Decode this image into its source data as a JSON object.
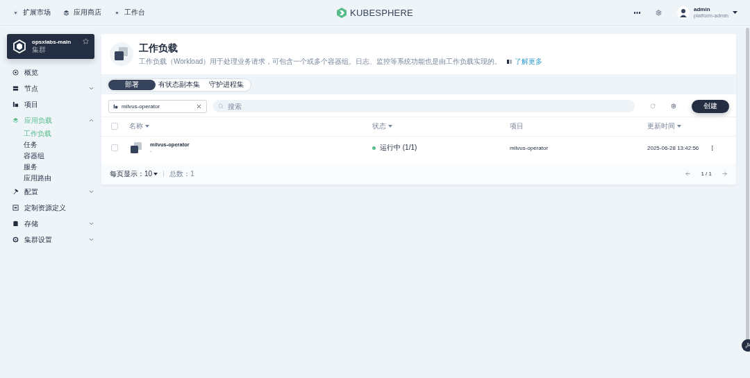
{
  "top_nav": {
    "links": [
      {
        "label": "扩展市场"
      },
      {
        "label": "应用商店"
      },
      {
        "label": "工作台"
      }
    ],
    "logo": "KUBESPHERE",
    "user": {
      "name": "admin",
      "role": "platform-admin"
    }
  },
  "cluster": {
    "name": "opsxlabs-main",
    "type": "集群",
    "starred": false
  },
  "sidebar": {
    "items": [
      {
        "label": "概览",
        "kind": "link",
        "selected": false
      },
      {
        "label": "节点",
        "kind": "group",
        "expanded": false,
        "selected": false
      },
      {
        "label": "项目",
        "kind": "link",
        "selected": false
      },
      {
        "label": "应用负载",
        "kind": "group",
        "expanded": true,
        "selected": true,
        "children": [
          {
            "label": "工作负载",
            "selected": true
          },
          {
            "label": "任务",
            "selected": false
          },
          {
            "label": "容器组",
            "selected": false
          },
          {
            "label": "服务",
            "selected": false
          },
          {
            "label": "应用路由",
            "selected": false
          }
        ]
      },
      {
        "label": "配置",
        "kind": "group",
        "expanded": false,
        "selected": false
      },
      {
        "label": "定制资源定义",
        "kind": "link",
        "selected": false
      },
      {
        "label": "存储",
        "kind": "group",
        "expanded": false,
        "selected": false
      },
      {
        "label": "集群设置",
        "kind": "group",
        "expanded": false,
        "selected": false
      }
    ]
  },
  "page_header": {
    "title": "工作负载",
    "description": "工作负载（Workload）用于处理业务请求，可包含一个或多个容器组。日志、监控等系统功能也是由工作负载实现的。",
    "learn_more": "了解更多"
  },
  "tabs": [
    {
      "label": "部署",
      "selected": true
    },
    {
      "label": "有状态副本集",
      "selected": false
    },
    {
      "label": "守护进程集",
      "selected": false
    }
  ],
  "toolbar": {
    "project_filter": "milvus-operator",
    "search": {
      "placeholder": "搜索"
    },
    "create_button": "创建"
  },
  "table": {
    "select_all": {
      "checked": false
    },
    "columns": [
      {
        "label": "名称",
        "sortable": true
      },
      {
        "label": "状态",
        "sortable": true
      },
      {
        "label": "项目",
        "sortable": false
      },
      {
        "label": "更新时间",
        "sortable": true
      }
    ],
    "rows": [
      {
        "checked": false,
        "name": "milvus-operator",
        "description": "-",
        "status": "运行中 (1/1)",
        "color": "#55bc8a",
        "project": "milvus-operator",
        "updated": "2025-06-28 13:42:56"
      }
    ]
  },
  "footer": {
    "page_size_label": "每页显示：",
    "page_size": "10",
    "total": "总数：1",
    "page": "1 / 1"
  }
}
